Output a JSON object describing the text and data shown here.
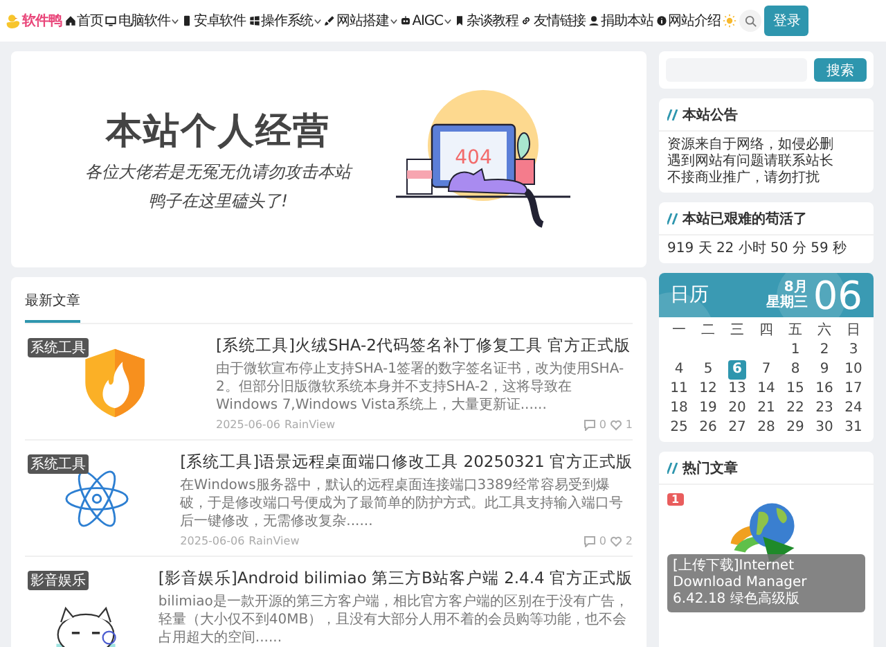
{
  "nav": {
    "logo": "软件鸭",
    "items": [
      {
        "label": "首页",
        "dropdown": false
      },
      {
        "label": "电脑软件",
        "dropdown": true
      },
      {
        "label": "安卓软件",
        "dropdown": false
      },
      {
        "label": "操作系统",
        "dropdown": true
      },
      {
        "label": "网站搭建",
        "dropdown": true
      },
      {
        "label": "AIGC",
        "dropdown": true
      },
      {
        "label": "杂谈教程",
        "dropdown": false
      },
      {
        "label": "友情链接",
        "dropdown": false
      },
      {
        "label": "捐助本站",
        "dropdown": false
      },
      {
        "label": "网站介绍",
        "dropdown": false
      }
    ],
    "login": "登录"
  },
  "banner": {
    "title": "本站个人经营",
    "lines": [
      "各位大佬若是无冤无仇请勿攻击本站",
      "鸭子在这里磕头了!"
    ],
    "screen_text": "404"
  },
  "latest": {
    "heading": "最新文章",
    "articles": [
      {
        "category": "系统工具",
        "title": "[系统工具]火绒SHA-2代码签名补丁修复工具 官方正式版",
        "excerpt": "由于微软宣布停止支持SHA-1签署的数字签名证书，改为使用SHA-2。但部分旧版微软系统本身并不支持SHA-2，这将导致在Windows 7,Windows Vista系统上，大量更新证......",
        "date": "2025-06-06",
        "author": "RainView",
        "comments": "0",
        "likes": "1"
      },
      {
        "category": "系统工具",
        "title": "[系统工具]语景远程桌面端口修改工具 20250321 官方正式版",
        "excerpt": "在Windows服务器中，默认的远程桌面连接端口3389经常容易受到爆破，于是修改端口号便成为了最简单的防护方式。此工具支持输入端口号后一键修改，无需修改复杂......",
        "date": "2025-06-06",
        "author": "RainView",
        "comments": "0",
        "likes": "2"
      },
      {
        "category": "影音娱乐",
        "title": "[影音娱乐]Android bilimiao 第三方B站客户端 2.4.4 官方正式版",
        "excerpt": "bilimiao是一款开源的第三方客户端，相比官方客户端的区别在于没有广告，轻量（大小仅不到40MB），且没有大部分人用不着的会员购等功能，也不会占用超大的空间......"
      }
    ]
  },
  "sidebar": {
    "search_button": "搜索",
    "notice": {
      "title": "本站公告",
      "lines": [
        "资源来自于网络，如侵必删",
        "遇到网站有问题请联系站长",
        "不接商业推广，请勿打扰"
      ]
    },
    "uptime": {
      "title": "本站已艰难的苟活了",
      "text": "919 天 22 小时 50 分 59 秒"
    },
    "calendar": {
      "title": "日历",
      "month": "8月",
      "weekday": "星期三",
      "day": "06",
      "weekdays": [
        "一",
        "二",
        "三",
        "四",
        "五",
        "六",
        "日"
      ],
      "weeks": [
        [
          {
            "day": "1",
            "selected": false
          },
          {
            "day": "2",
            "selected": false
          },
          {
            "day": "3",
            "selected": false
          }
        ],
        [
          {
            "day": "4",
            "selected": false
          },
          {
            "day": "5",
            "selected": false
          },
          {
            "day": "6",
            "selected": true
          },
          {
            "day": "7",
            "selected": false
          },
          {
            "day": "8",
            "selected": false
          },
          {
            "day": "9",
            "selected": false
          },
          {
            "day": "10",
            "selected": false
          }
        ],
        [
          {
            "day": "11",
            "selected": false
          },
          {
            "day": "12",
            "selected": false
          },
          {
            "day": "13",
            "selected": false
          },
          {
            "day": "14",
            "selected": false
          },
          {
            "day": "15",
            "selected": false
          },
          {
            "day": "16",
            "selected": false
          },
          {
            "day": "17",
            "selected": false
          }
        ],
        [
          {
            "day": "18",
            "selected": false
          },
          {
            "day": "19",
            "selected": false
          },
          {
            "day": "20",
            "selected": false
          },
          {
            "day": "21",
            "selected": false
          },
          {
            "day": "22",
            "selected": false
          },
          {
            "day": "23",
            "selected": false
          },
          {
            "day": "24",
            "selected": false
          }
        ],
        [
          {
            "day": "25",
            "selected": false
          },
          {
            "day": "26",
            "selected": false
          },
          {
            "day": "27",
            "selected": false
          },
          {
            "day": "28",
            "selected": false
          },
          {
            "day": "29",
            "selected": false
          },
          {
            "day": "30",
            "selected": false
          },
          {
            "day": "31",
            "selected": false
          }
        ]
      ]
    },
    "hot": {
      "title": "热门文章",
      "items": [
        {
          "rank": "1",
          "caption": "[上传下载]Internet Download Manager 6.42.18 绿色高级版"
        }
      ]
    }
  }
}
